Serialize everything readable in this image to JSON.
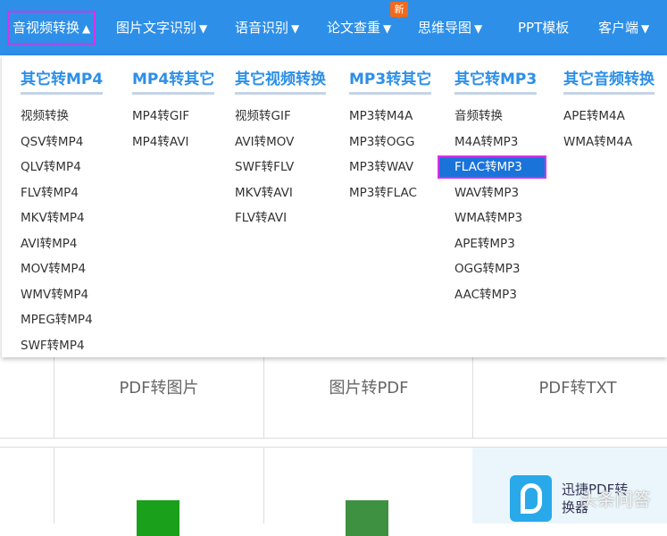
{
  "nav": [
    {
      "label": "音视频转换",
      "arrow": "▲"
    },
    {
      "label": "图片文字识别",
      "arrow": "▼"
    },
    {
      "label": "语音识别",
      "arrow": "▼"
    },
    {
      "label": "论文查重",
      "arrow": "▼"
    },
    {
      "label": "思维导图",
      "arrow": "▼"
    },
    {
      "label": "PPT模板",
      "arrow": ""
    },
    {
      "label": "客户端",
      "arrow": "▼"
    }
  ],
  "badge": "新",
  "columns": [
    {
      "title": "其它转MP4",
      "items": [
        "视频转换",
        "QSV转MP4",
        "QLV转MP4",
        "FLV转MP4",
        "MKV转MP4",
        "AVI转MP4",
        "MOV转MP4",
        "WMV转MP4",
        "MPEG转MP4",
        "SWF转MP4"
      ]
    },
    {
      "title": "MP4转其它",
      "items": [
        "MP4转GIF",
        "MP4转AVI"
      ]
    },
    {
      "title": "其它视频转换",
      "items": [
        "视频转GIF",
        "AVI转MOV",
        "SWF转FLV",
        "MKV转AVI",
        "FLV转AVI"
      ]
    },
    {
      "title": "MP3转其它",
      "items": [
        "MP3转M4A",
        "MP3转OGG",
        "MP3转WAV",
        "MP3转FLAC"
      ]
    },
    {
      "title": "其它转MP3",
      "items": [
        "音频转换",
        "M4A转MP3",
        "FLAC转MP3",
        "WAV转MP3",
        "WMA转MP3",
        "APE转MP3",
        "OGG转MP3",
        "AAC转MP3"
      ]
    },
    {
      "title": "其它音频转换",
      "items": [
        "APE转M4A",
        "WMA转M4A"
      ]
    }
  ],
  "selected": "FLAC转MP3",
  "tools": [
    "PDF转图片",
    "图片转PDF",
    "PDF转TXT"
  ],
  "promo": {
    "line1": "迅捷PDF转",
    "line2": "换器",
    "watermark": "头条问答"
  }
}
